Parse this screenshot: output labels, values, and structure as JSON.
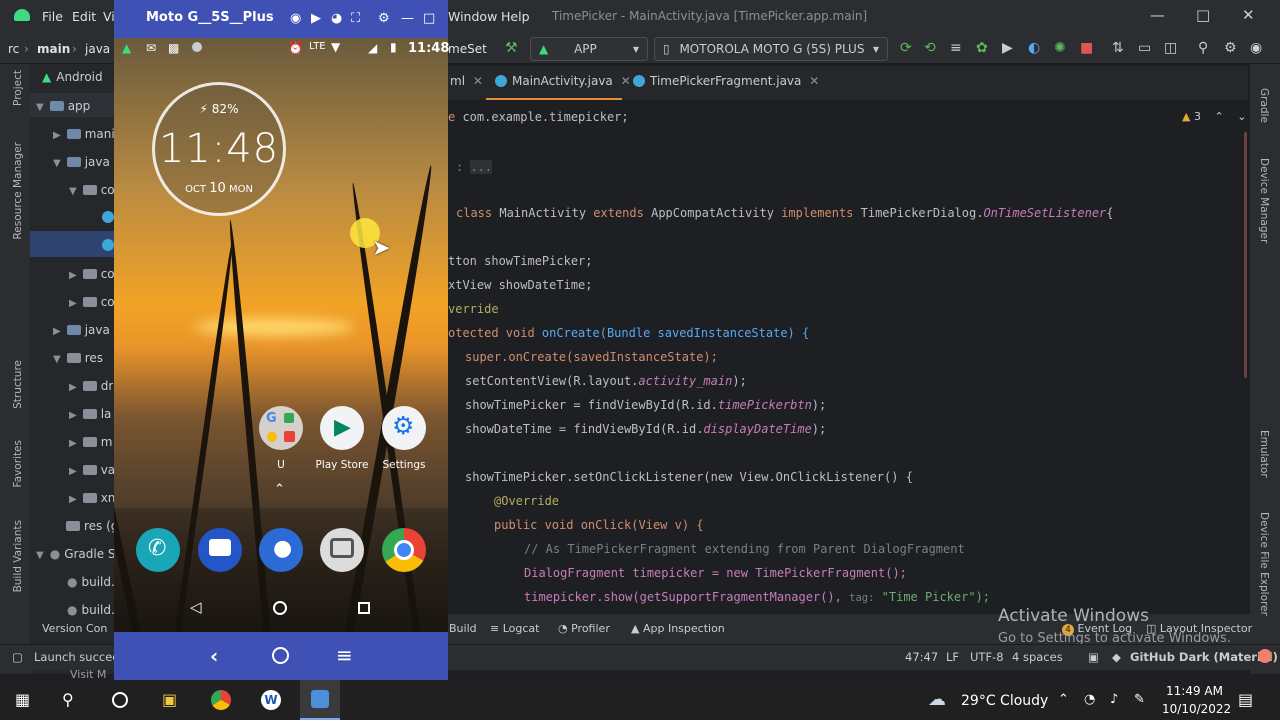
{
  "ide": {
    "menu": [
      "File",
      "Edit",
      "Vi",
      "Window",
      "Help"
    ],
    "window_title": "TimePicker - MainActivity.java [TimePicker.app.main]",
    "breadcrumb": [
      "rc",
      "main",
      "java"
    ],
    "run_config_fragment": "meSet",
    "app_config": "APP",
    "device": "MOTOROLA MOTO G (5S) PLUS",
    "tabs": [
      "ml",
      "MainActivity.java",
      "TimePickerFragment.java"
    ],
    "warnings": "3",
    "left_tools": [
      "Project",
      "Resource Manager",
      "Structure",
      "Favorites",
      "Build Variants"
    ],
    "right_tools": [
      "Gradle",
      "Device Manager",
      "Emulator",
      "Device File Explorer"
    ],
    "project_tree": [
      {
        "label": "Android"
      },
      {
        "label": "app"
      },
      {
        "label": "manif"
      },
      {
        "label": "java"
      },
      {
        "label": "co"
      },
      {
        "label": "co"
      },
      {
        "label": "co"
      },
      {
        "label": "java ("
      },
      {
        "label": "res"
      },
      {
        "label": "dr"
      },
      {
        "label": "la"
      },
      {
        "label": "m"
      },
      {
        "label": "va"
      },
      {
        "label": "xn"
      },
      {
        "label": "res (g"
      },
      {
        "label": "Gradle S"
      },
      {
        "label": "build."
      },
      {
        "label": "build."
      },
      {
        "label": "Version Con"
      }
    ],
    "code": {
      "l1": "com.example.timepicker;",
      "l2": "...",
      "l3_class": "MainActivity",
      "l3_ext": "AppCompatActivity",
      "l3_impl": "TimePickerDialog.",
      "l3_iface": "OnTimeSetListener",
      "l4": "showTimePicker;",
      "l5": "showDateTime;",
      "l6": "verride",
      "l7": "onCreate(Bundle savedInstanceState) {",
      "l8": "super.onCreate(savedInstanceState);",
      "l9a": "setContentView(R.layout.",
      "l9b": "activity_main",
      "l10a": "showTimePicker = findViewById(R.id.",
      "l10b": "timePickerbtn",
      "l11a": "showDateTime = findViewById(R.id.",
      "l11b": "displayDateTime",
      "l12": "showTimePicker.setOnClickListener(new View.OnClickListener() {",
      "l13": "@Override",
      "l14": "public void onClick(View v) {",
      "l15": "// As TimePickerFragment extending from Parent DialogFragment",
      "l16": "DialogFragment timepicker = new TimePickerFragment();",
      "l17a": "timepicker.show(getSupportFragmentManager(),",
      "l17tag": "tag:",
      "l17b": "\"Time Picker\");"
    },
    "bottom_tools": [
      "Build",
      "Logcat",
      "Profiler",
      "App Inspection"
    ],
    "event_log": "Event Log",
    "event_count": "4",
    "layout_inspector": "Layout Inspector",
    "activate1": "Activate Windows",
    "activate2": "Go to Settings to activate Windows.",
    "status": {
      "left": "Launch succeeded",
      "position": "47:47",
      "line_sep": "LF",
      "encoding": "UTF-8",
      "indent": "4 spaces",
      "theme": "GitHub Dark (Material)"
    },
    "behind_text": "Visit M"
  },
  "emulator": {
    "title": "Moto G__5S__Plus",
    "phone_time": "11:48",
    "battery": "82%",
    "clock": "11:48",
    "date_prefix": "OCT",
    "date_day": "10",
    "date_suffix": "MON",
    "apps": [
      {
        "label": "U"
      },
      {
        "label": "Play Store"
      },
      {
        "label": "Settings"
      }
    ]
  },
  "taskbar": {
    "weather": "29°C  Cloudy",
    "time": "11:49 AM",
    "date": "10/10/2022"
  }
}
